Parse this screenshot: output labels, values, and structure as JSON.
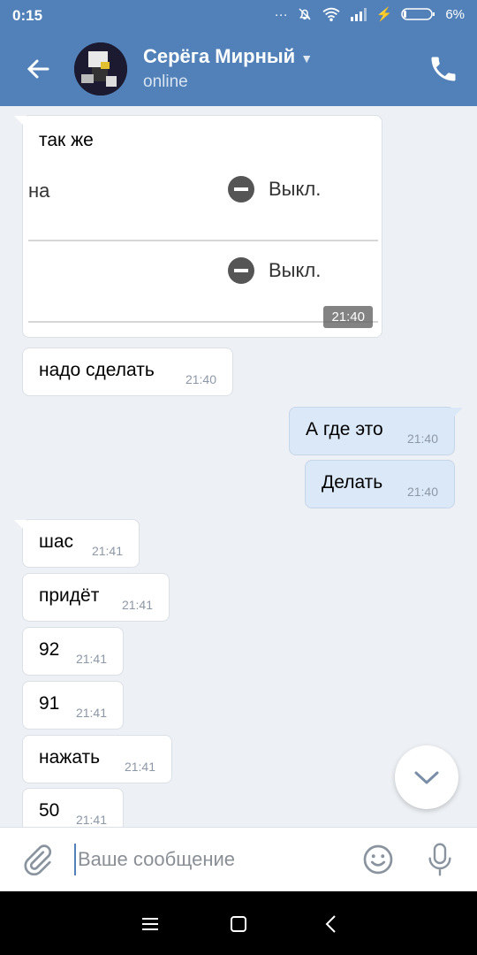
{
  "status_bar": {
    "time": "0:15",
    "battery": "6%"
  },
  "header": {
    "name": "Серёга Мирный",
    "status": "online"
  },
  "messages": [
    {
      "type": "incoming-image",
      "caption": "так же",
      "rows": [
        {
          "left": "на",
          "right": "Выкл."
        },
        {
          "left": "",
          "right": "Выкл."
        }
      ],
      "time": "21:40"
    },
    {
      "type": "incoming",
      "text": "надо сделать",
      "time": "21:40"
    },
    {
      "type": "outgoing",
      "text": "А где это",
      "time": "21:40"
    },
    {
      "type": "outgoing",
      "text": "Делать",
      "time": "21:40"
    },
    {
      "type": "incoming",
      "text": "шас",
      "time": "21:41"
    },
    {
      "type": "incoming",
      "text": "придёт",
      "time": "21:41"
    },
    {
      "type": "incoming",
      "text": "92",
      "time": "21:41"
    },
    {
      "type": "incoming",
      "text": "91",
      "time": "21:41"
    },
    {
      "type": "incoming",
      "text": "нажать",
      "time": "21:41"
    },
    {
      "type": "incoming",
      "text": "50",
      "time": "21:41"
    }
  ],
  "composer": {
    "placeholder": "Ваше сообщение"
  },
  "colors": {
    "header": "#5181b8",
    "outgoing_bubble": "#dbe8f7",
    "background": "#edf0f4"
  },
  "icons": [
    "back-arrow-icon",
    "phone-icon",
    "chevron-down-icon",
    "paperclip-icon",
    "smile-icon",
    "microphone-icon",
    "menu-icon",
    "square-icon",
    "back-nav-icon"
  ]
}
